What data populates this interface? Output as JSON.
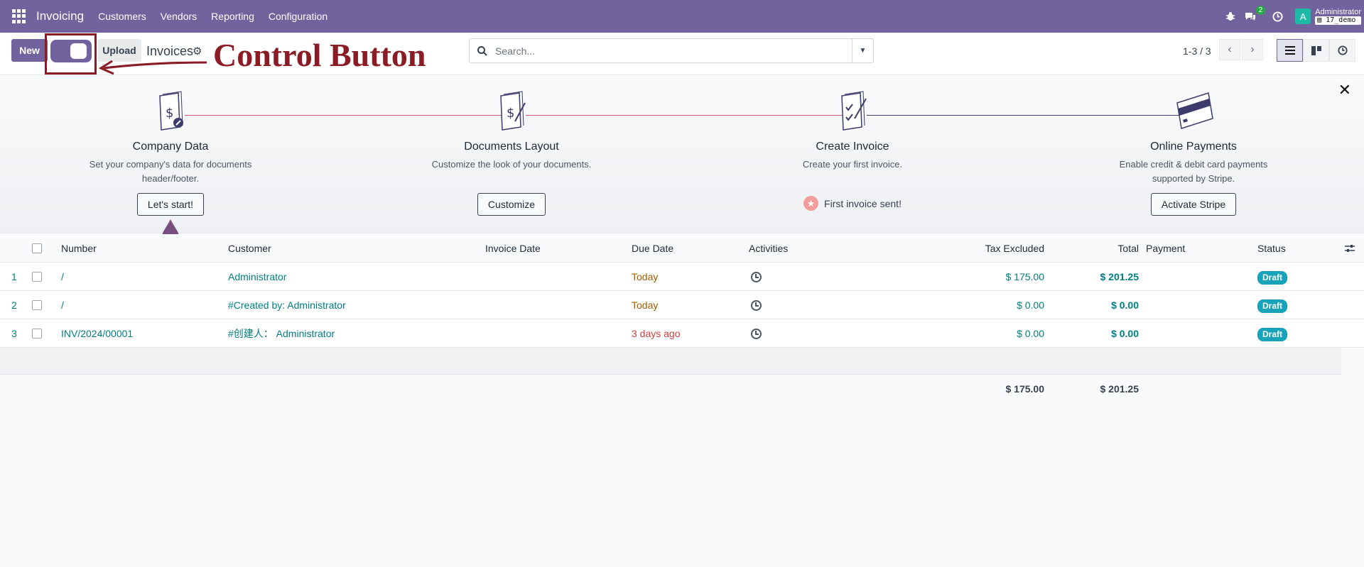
{
  "navbar": {
    "brand": "Invoicing",
    "menu": [
      "Customers",
      "Vendors",
      "Reporting",
      "Configuration"
    ],
    "chat_badge": "2",
    "avatar_letter": "A",
    "user_name": "Administrator",
    "db_name": "17_demo"
  },
  "controlbar": {
    "new_label": "New",
    "upload_label": "Upload",
    "breadcrumb": "Invoices",
    "annotation": "Control Button",
    "search_placeholder": "Search...",
    "pager": "1-3 / 3"
  },
  "onboarding": {
    "steps": [
      {
        "title": "Company Data",
        "desc": "Set your company's data for documents header/footer.",
        "button": "Let's start!"
      },
      {
        "title": "Documents Layout",
        "desc": "Customize the look of your documents.",
        "button": "Customize"
      },
      {
        "title": "Create Invoice",
        "desc": "Create your first invoice.",
        "done": "First invoice sent!"
      },
      {
        "title": "Online Payments",
        "desc": "Enable credit & debit card payments supported by Stripe.",
        "button": "Activate Stripe"
      }
    ]
  },
  "table": {
    "columns": [
      "Number",
      "Customer",
      "Invoice Date",
      "Due Date",
      "Activities",
      "Tax Excluded",
      "Total",
      "Payment",
      "Status"
    ],
    "rows": [
      {
        "no": "1",
        "number": "/",
        "customer": "Administrator",
        "invoice_date": "",
        "due": "Today",
        "tax_excl": "$ 175.00",
        "total": "$ 201.25",
        "status": "Draft"
      },
      {
        "no": "2",
        "number": "/",
        "customer": "#Created by: Administrator",
        "invoice_date": "",
        "due": "Today",
        "tax_excl": "$ 0.00",
        "total": "$ 0.00",
        "status": "Draft"
      },
      {
        "no": "3",
        "number": "INV/2024/00001",
        "customer": "#创建人： Administrator",
        "invoice_date": "",
        "due": "3 days ago",
        "tax_excl": "$ 0.00",
        "total": "$ 0.00",
        "status": "Draft"
      }
    ],
    "totals": {
      "tax_excl": "$ 175.00",
      "total": "$ 201.25"
    }
  },
  "colors": {
    "brand": "#71639e",
    "annotation": "#8b1c25",
    "link": "#017e84",
    "draft": "#17a2b8"
  }
}
